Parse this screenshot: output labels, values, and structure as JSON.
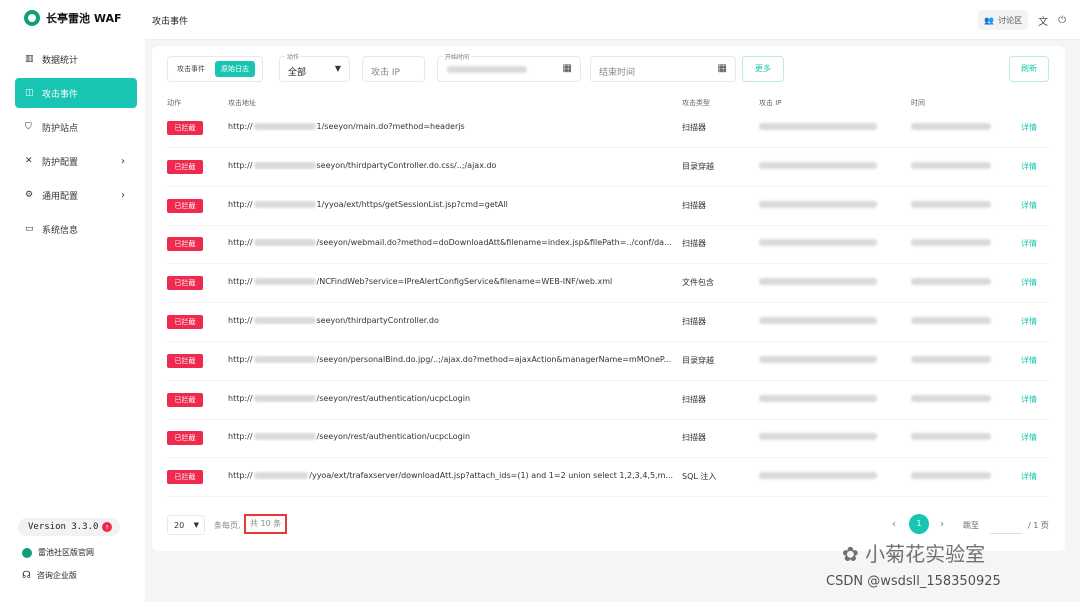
{
  "app": {
    "title": "长亭雷池 WAF"
  },
  "sidebar": {
    "items": [
      {
        "label": "数据统计",
        "icon": "bar-chart-icon"
      },
      {
        "label": "攻击事件",
        "icon": "alert-icon",
        "active": true
      },
      {
        "label": "防护站点",
        "icon": "shield-icon"
      },
      {
        "label": "防护配置",
        "icon": "wrench-icon",
        "has_children": true
      },
      {
        "label": "通用配置",
        "icon": "gear-icon",
        "has_children": true
      },
      {
        "label": "系统信息",
        "icon": "info-icon"
      }
    ],
    "version": "Version 3.3.0",
    "version_badge": "↑",
    "link_community": "雷池社区版官网",
    "link_enterprise": "咨询企业版"
  },
  "header": {
    "page_title": "攻击事件",
    "discuss": "讨论区"
  },
  "filters": {
    "tab_events": "攻击事件",
    "tab_logs": "原始日志",
    "action_label": "动作",
    "action_value": "全部",
    "ip_placeholder": "攻击 IP",
    "start_label": "开始时间",
    "end_placeholder": "结束时间",
    "more": "更多",
    "refresh": "刷新"
  },
  "table": {
    "headers": {
      "action": "动作",
      "url": "攻击地址",
      "type": "攻击类型",
      "ip": "攻击 IP",
      "time": "时间"
    },
    "detail_label": "详情",
    "rows": [
      {
        "action": "已拦截",
        "url_prefix": "http://",
        "url_suffix": "1/seeyon/main.do?method=headerjs",
        "type": "扫描器"
      },
      {
        "action": "已拦截",
        "url_prefix": "http://",
        "url_suffix": "seeyon/thirdpartyController.do.css/..;/ajax.do",
        "type": "目录穿越"
      },
      {
        "action": "已拦截",
        "url_prefix": "http://",
        "url_suffix": "1/yyoa/ext/https/getSessionList.jsp?cmd=getAll",
        "type": "扫描器"
      },
      {
        "action": "已拦截",
        "url_prefix": "http://",
        "url_suffix": "/seeyon/webmail.do?method=doDownloadAtt&filename=index.jsp&filePath=../conf/da...",
        "type": "扫描器"
      },
      {
        "action": "已拦截",
        "url_prefix": "http://",
        "url_suffix": "/NCFindWeb?service=IPreAlertConfigService&filename=WEB-INF/web.xml",
        "type": "文件包含"
      },
      {
        "action": "已拦截",
        "url_prefix": "http://",
        "url_suffix": "seeyon/thirdpartyController.do",
        "type": "扫描器"
      },
      {
        "action": "已拦截",
        "url_prefix": "http://",
        "url_suffix": "/seeyon/personalBind.do.jpg/..;/ajax.do?method=ajaxAction&managerName=mMOneP...",
        "type": "目录穿越"
      },
      {
        "action": "已拦截",
        "url_prefix": "http://",
        "url_suffix": "/seeyon/rest/authentication/ucpcLogin",
        "type": "扫描器"
      },
      {
        "action": "已拦截",
        "url_prefix": "http://",
        "url_suffix": "/seeyon/rest/authentication/ucpcLogin",
        "type": "扫描器"
      },
      {
        "action": "已拦截",
        "url_prefix": "http://",
        "url_suffix": "/yyoa/ext/trafaxserver/downloadAtt.jsp?attach_ids=(1) and 1=2 union select 1,2,3,4,5,m...",
        "type": "SQL 注入"
      }
    ]
  },
  "pagination": {
    "page_size": "20",
    "per_page_label": "条每页,",
    "total": "共 10 条",
    "current_page": "1",
    "jump_label": "跳至",
    "pages_total": "/ 1 页"
  },
  "watermarks": {
    "wechat": "小菊花实验室",
    "csdn": "CSDN @wsdsll_158350925"
  },
  "colors": {
    "accent": "#18c4b2",
    "danger": "#ef2a4f"
  }
}
